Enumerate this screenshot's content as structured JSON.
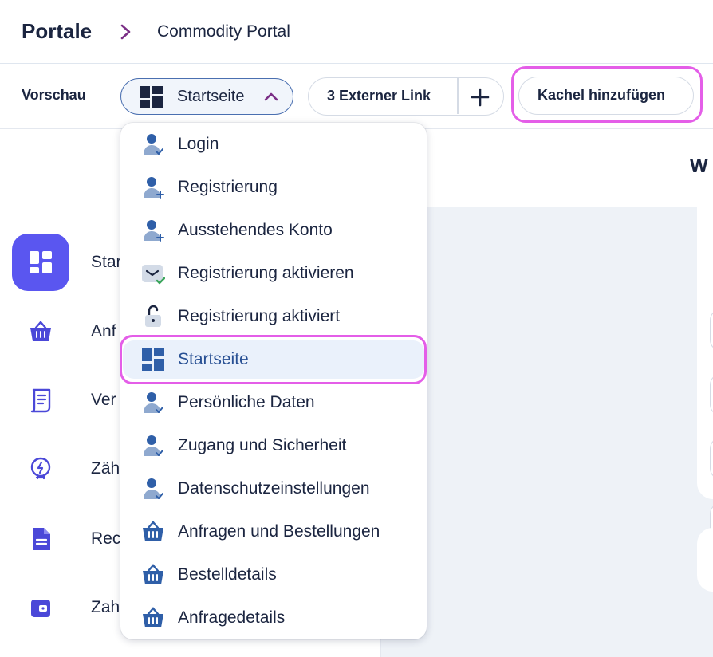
{
  "header": {
    "title": "Portale",
    "breadcrumb": "Commodity Portal"
  },
  "toolbar": {
    "preview_label": "Vorschau",
    "page_select": "Startseite",
    "external_links": "3 Externer Link",
    "add_tile": "Kachel hinzufügen"
  },
  "sidebar": {
    "items": [
      {
        "label": "Star",
        "icon": "dashboard-icon",
        "active": true
      },
      {
        "label": "Anf",
        "icon": "basket-icon"
      },
      {
        "label": "Ver",
        "icon": "contract-icon"
      },
      {
        "label": "Zäh",
        "icon": "meter-icon"
      },
      {
        "label": "Rec",
        "icon": "document-icon"
      },
      {
        "label": "Zah",
        "icon": "wallet-icon"
      }
    ]
  },
  "content": {
    "title": "W"
  },
  "dropdown": {
    "items": [
      {
        "label": "Login",
        "icon": "user-check-icon"
      },
      {
        "label": "Registrierung",
        "icon": "user-plus-icon"
      },
      {
        "label": "Ausstehendes Konto",
        "icon": "user-plus-icon"
      },
      {
        "label": "Registrierung aktivieren",
        "icon": "mail-check-icon"
      },
      {
        "label": "Registrierung aktiviert",
        "icon": "unlock-icon"
      },
      {
        "label": "Startseite",
        "icon": "dashboard-icon",
        "selected": true
      },
      {
        "label": "Persönliche Daten",
        "icon": "user-check-icon"
      },
      {
        "label": "Zugang und Sicherheit",
        "icon": "user-check-icon"
      },
      {
        "label": "Datenschutzeinstellungen",
        "icon": "user-check-icon"
      },
      {
        "label": "Anfragen und Bestellungen",
        "icon": "basket-icon"
      },
      {
        "label": "Bestelldetails",
        "icon": "basket-icon"
      },
      {
        "label": "Anfragedetails",
        "icon": "basket-icon"
      }
    ]
  },
  "colors": {
    "accent": "#5a56f0",
    "highlight": "#e45ee8",
    "text": "#1b2540",
    "icon_blue": "#2f5fa8"
  }
}
